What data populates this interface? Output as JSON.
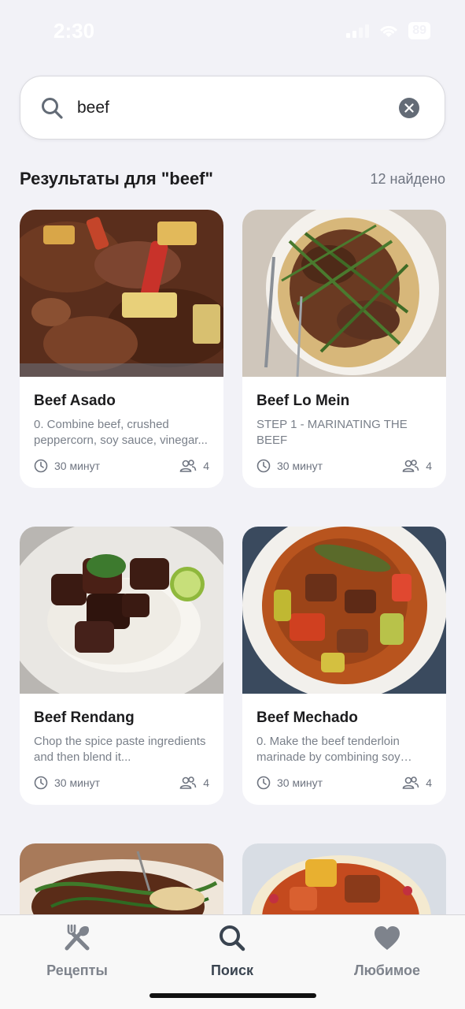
{
  "status_bar": {
    "time": "2:30",
    "battery": "89"
  },
  "search": {
    "value": "beef",
    "placeholder": ""
  },
  "results": {
    "title": "Результаты для \"beef\"",
    "count": "12 найдено"
  },
  "cards": [
    {
      "title": "Beef Asado",
      "description": "0.      Combine beef, crushed peppercorn, soy sauce, vinegar...",
      "time": "30 минут",
      "servings": "4"
    },
    {
      "title": "Beef Lo Mein",
      "description": "STEP 1 - MARINATING THE BEEF",
      "time": "30 минут",
      "servings": "4"
    },
    {
      "title": "Beef Rendang",
      "description": "Chop the spice paste ingredients and then blend it...",
      "time": "30 минут",
      "servings": "4"
    },
    {
      "title": "Beef Mechado",
      "description": "0.      Make the beef tenderloin marinade by combining soy sauce...",
      "time": "30 минут",
      "servings": "4"
    }
  ],
  "tabs": [
    {
      "label": "Рецепты",
      "icon": "utensils-icon",
      "active": false
    },
    {
      "label": "Поиск",
      "icon": "search-icon",
      "active": true
    },
    {
      "label": "Любимое",
      "icon": "heart-icon",
      "active": false
    }
  ],
  "colors": {
    "background": "#f2f2f7",
    "card": "#ffffff",
    "muted": "#7a808a",
    "active_tab": "#3a4450",
    "inactive_tab": "#7e838c"
  }
}
